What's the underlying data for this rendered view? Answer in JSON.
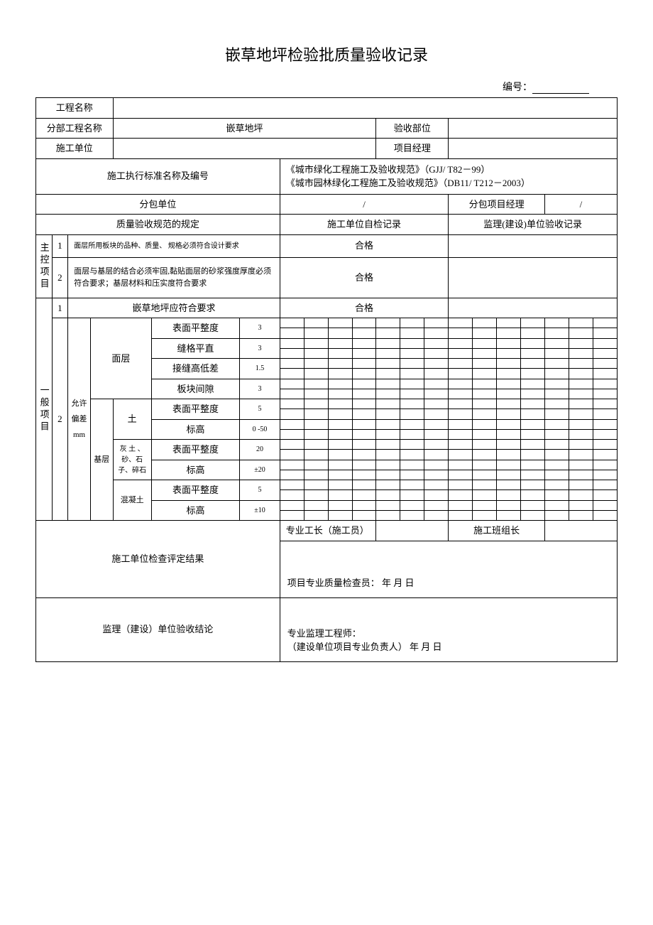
{
  "title": "嵌草地坪检验批质量验收记录",
  "docNumLabel": "编号：",
  "header": {
    "projectNameLabel": "工程名称",
    "subProjectLabel": "分部工程名称",
    "subProjectValue": "嵌草地坪",
    "acceptPartLabel": "验收部位",
    "constructUnitLabel": "施工单位",
    "projectManagerLabel": "项目经理",
    "standardLabel": "施工执行标准名称及编号",
    "standardValue1": "《城市绿化工程施工及验收规范》（GJJ/ T82－99）",
    "standardValue2": "《城市园林绿化工程施工及验收规范》（DB11/ T212－2003）",
    "subcontractorLabel": "分包单位",
    "subcontractorValue": "/",
    "subProjectMgrLabel": "分包项目经理",
    "subProjectMgrValue": "/",
    "qualityRuleLabel": "质量验收规范的规定",
    "selfCheckLabel": "施工单位自检记录",
    "supervisionLabel": "监理(建设)单位验收记录"
  },
  "mainControl": {
    "groupLabel": "主控项目",
    "row1": {
      "num": "1",
      "desc": "面层所用板块的品种、质量、 规格必须符合设计要求",
      "result": "合格"
    },
    "row2": {
      "num": "2",
      "desc": "面层与基层的结合必须牢固,黏贴面层的砂浆强度厚度必须符合要求；基层材料和压实度符合要求",
      "result": "合格"
    }
  },
  "general": {
    "groupLabel": "一般项目",
    "row1": {
      "num": "1",
      "desc": "嵌草地坪应符合要求",
      "result": "合格"
    },
    "row2Num": "2",
    "tolLabel": "允许偏差mm",
    "surface": {
      "label": "面层",
      "items": [
        {
          "name": "表面平整度",
          "val": "3"
        },
        {
          "name": "缝格平直",
          "val": "3"
        },
        {
          "name": "接缝高低差",
          "val": "1.5"
        },
        {
          "name": "板块间隙",
          "val": "3"
        }
      ]
    },
    "base": {
      "label": "基层",
      "soil": {
        "label": "土",
        "items": [
          {
            "name": "表面平整度",
            "val": "5"
          },
          {
            "name": "标高",
            "val": "0  -50"
          }
        ]
      },
      "gravel": {
        "label": "灰 土 、砂、石子、碎石",
        "items": [
          {
            "name": "表面平整度",
            "val": "20"
          },
          {
            "name": "标高",
            "val": "±20"
          }
        ]
      },
      "concrete": {
        "label": "混凝土",
        "items": [
          {
            "name": "表面平整度",
            "val": "5"
          },
          {
            "name": "标高",
            "val": "±10"
          }
        ]
      }
    }
  },
  "footer": {
    "checkResultLabel": "施工单位检查评定结果",
    "foremanLabel": "专业工长（施工员）",
    "teamLeaderLabel": "施工班组长",
    "qualityInspector": "项目专业质量检查员：                          年       月       日",
    "supervisionConclusionLabel": "监理（建设）单位验收结论",
    "supervisionEngineer": "专业监理工程师：",
    "constructManager": "（建设单位项目专业负责人）              年       月       日"
  }
}
